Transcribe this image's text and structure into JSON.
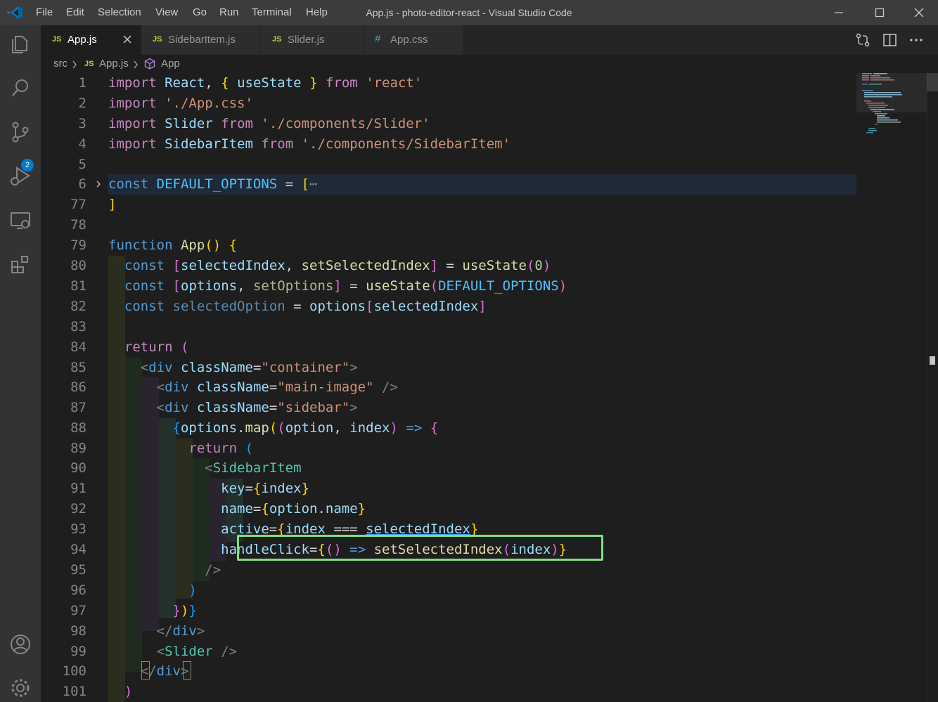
{
  "window": {
    "title": "App.js - photo-editor-react - Visual Studio Code",
    "menu": [
      "File",
      "Edit",
      "Selection",
      "View",
      "Go",
      "Run",
      "Terminal",
      "Help"
    ]
  },
  "activity_bar": {
    "icons": [
      "explorer-icon",
      "search-icon",
      "source-control-icon",
      "run-debug-icon",
      "remote-explorer-icon",
      "extensions-icon",
      "account-icon",
      "settings-gear-icon"
    ],
    "scm_badge": "2"
  },
  "tabs": [
    {
      "icon": "JS",
      "label": "App.js",
      "active": true
    },
    {
      "icon": "JS",
      "label": "SidebarItem.js",
      "active": false
    },
    {
      "icon": "JS",
      "label": "Slider.js",
      "active": false
    },
    {
      "icon": "#",
      "label": "App.css",
      "active": false
    }
  ],
  "breadcrumb": {
    "folder": "src",
    "file_icon": "JS",
    "file": "App.js",
    "symbol": "App"
  },
  "editor": {
    "line_numbers": [
      "1",
      "2",
      "3",
      "4",
      "5",
      "6",
      "77",
      "78",
      "79",
      "80",
      "81",
      "82",
      "83",
      "84",
      "85",
      "86",
      "87",
      "88",
      "89",
      "90",
      "91",
      "92",
      "93",
      "94",
      "95",
      "96",
      "97",
      "98",
      "99",
      "100",
      "101"
    ],
    "folded_marker": "⋯",
    "highlighted_line": "94"
  },
  "colors": {
    "background": "#1e1e1e",
    "activity_bar": "#333333",
    "title_bar": "#3c3c3c",
    "accent": "#007acc",
    "highlight_box": "#7fe07f"
  }
}
